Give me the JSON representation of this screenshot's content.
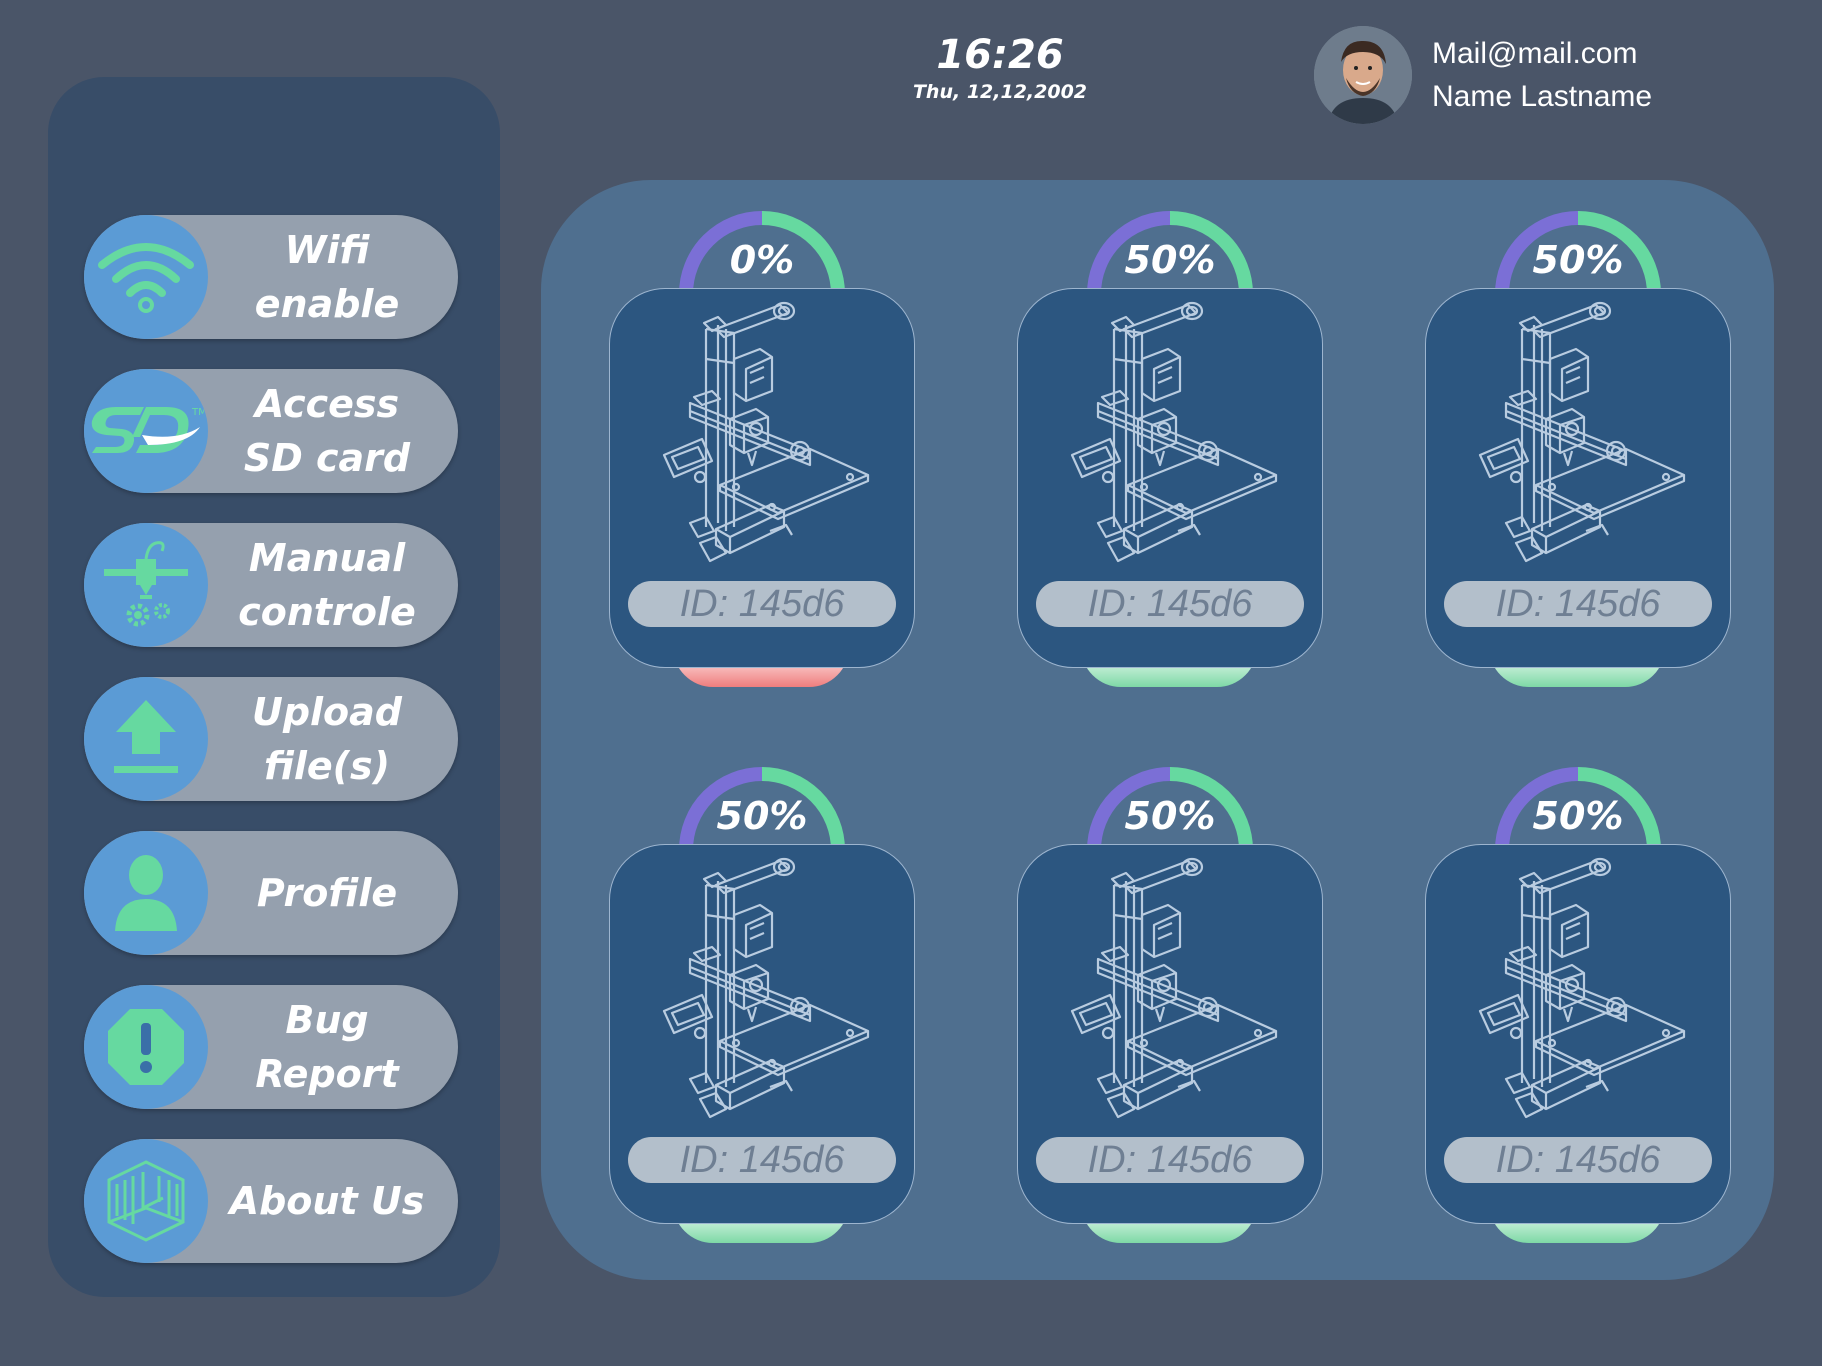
{
  "header": {
    "time": "16:26",
    "date": "Thu, 12,12,2002"
  },
  "user": {
    "email": "Mail@mail.com",
    "name": "Name Lastname"
  },
  "sidebar": {
    "items": [
      {
        "label": "Wifi enable",
        "icon": "wifi-icon"
      },
      {
        "label": "Access\nSD card",
        "icon": "sd-card-icon"
      },
      {
        "label": "Manual\ncontrole",
        "icon": "extruder-gear-icon"
      },
      {
        "label": "Upload\nfile(s)",
        "icon": "upload-icon"
      },
      {
        "label": "Profile",
        "icon": "user-icon"
      },
      {
        "label": "Bug Report",
        "icon": "alert-octagon-icon"
      },
      {
        "label": "About Us",
        "icon": "cube-logo-icon"
      }
    ]
  },
  "printers": [
    {
      "progress_label": "0%",
      "progress": 0.0,
      "id": "ID: 145d6",
      "status": "error",
      "status_color": "#ef7d7d"
    },
    {
      "progress_label": "50%",
      "progress": 0.5,
      "id": "ID: 145d6",
      "status": "ok",
      "status_color": "#7ed9a6"
    },
    {
      "progress_label": "50%",
      "progress": 0.5,
      "id": "ID: 145d6",
      "status": "ok",
      "status_color": "#7ed9a6"
    },
    {
      "progress_label": "50%",
      "progress": 0.5,
      "id": "ID: 145d6",
      "status": "ok",
      "status_color": "#7ed9a6"
    },
    {
      "progress_label": "50%",
      "progress": 0.5,
      "id": "ID: 145d6",
      "status": "ok",
      "status_color": "#7ed9a6"
    },
    {
      "progress_label": "50%",
      "progress": 0.5,
      "id": "ID: 145d6",
      "status": "ok",
      "status_color": "#7ed9a6"
    }
  ],
  "colors": {
    "background": "#4a5568",
    "sidebar": "#384d68",
    "panel": "#4f6f8f",
    "card": "#2c5680",
    "icon_circle": "#5b9bd5",
    "icon_green": "#66d9a0",
    "gauge_start": "#7b6fd6",
    "gauge_end": "#66d9a0"
  }
}
